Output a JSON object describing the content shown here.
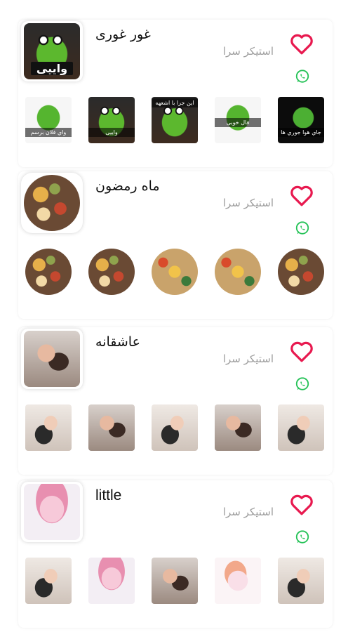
{
  "colors": {
    "heart": "#e8194f",
    "whatsapp": "#25c257",
    "author": "#9e9e9e"
  },
  "packs": [
    {
      "title": "غور غوری",
      "author": "استیکر سرا",
      "thumb_caption": "واییی",
      "sticker_captions": [
        "واي فلان برسم",
        "واییی",
        "اين جرا با اشعهه",
        "فال خوبی",
        "جاي هوا جوري ها"
      ]
    },
    {
      "title": "ماه رمضون",
      "author": "استیکر سرا"
    },
    {
      "title": "عاشقانه",
      "author": "استیکر سرا"
    },
    {
      "title": "little",
      "author": "استیکر سرا"
    }
  ],
  "icons": {
    "favorite": "heart-outline-icon",
    "share": "whatsapp-icon"
  }
}
